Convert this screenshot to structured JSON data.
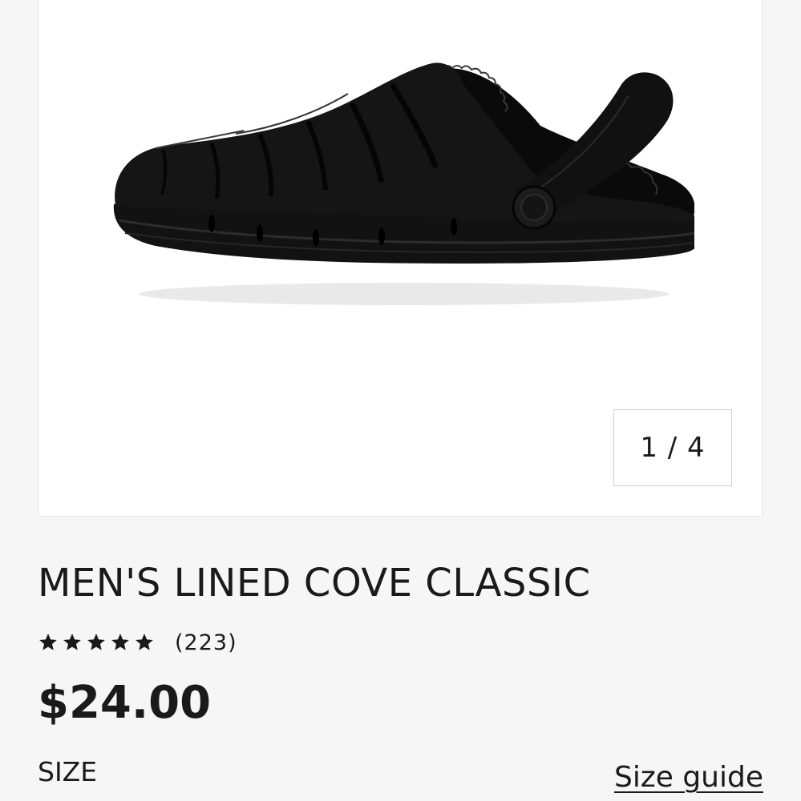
{
  "gallery": {
    "counter": "1 / 4"
  },
  "product": {
    "title": "MEN'S LINED COVE CLASSIC",
    "rating": 5,
    "review_count": "(223)",
    "price": "$24.00"
  },
  "size_section": {
    "label": "SIZE",
    "guide_link": "Size guide"
  },
  "colors": {
    "text": "#1a1a1a",
    "background": "#f6f6f6",
    "card": "#ffffff"
  },
  "icons": {
    "star": "star-icon"
  }
}
